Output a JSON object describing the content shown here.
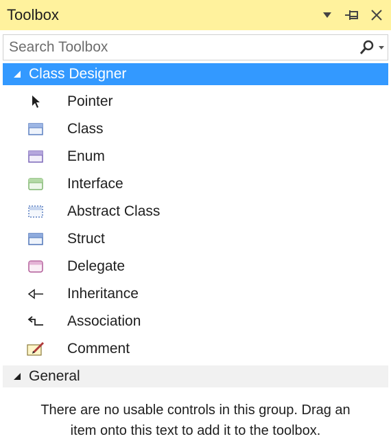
{
  "window": {
    "title": "Toolbox",
    "controls": {
      "dropdown": "▼",
      "pin": "pin",
      "close": "✕"
    }
  },
  "search": {
    "placeholder": "Search Toolbox"
  },
  "groups": [
    {
      "label": "Class Designer",
      "expanded": true,
      "items": [
        {
          "label": "Pointer",
          "icon": "pointer-icon"
        },
        {
          "label": "Class",
          "icon": "class-icon"
        },
        {
          "label": "Enum",
          "icon": "enum-icon"
        },
        {
          "label": "Interface",
          "icon": "interface-icon"
        },
        {
          "label": "Abstract Class",
          "icon": "abstract-class-icon"
        },
        {
          "label": "Struct",
          "icon": "struct-icon"
        },
        {
          "label": "Delegate",
          "icon": "delegate-icon"
        },
        {
          "label": "Inheritance",
          "icon": "inheritance-icon"
        },
        {
          "label": "Association",
          "icon": "association-icon"
        },
        {
          "label": "Comment",
          "icon": "comment-icon"
        }
      ]
    },
    {
      "label": "General",
      "expanded": true,
      "message_line1": "There are no usable controls in this group. Drag an",
      "message_line2": "item onto this text to add it to the toolbox."
    }
  ],
  "colors": {
    "title_bar": "#fff29d",
    "selected_group": "#3399ff",
    "general_group": "#f1f1f1"
  }
}
